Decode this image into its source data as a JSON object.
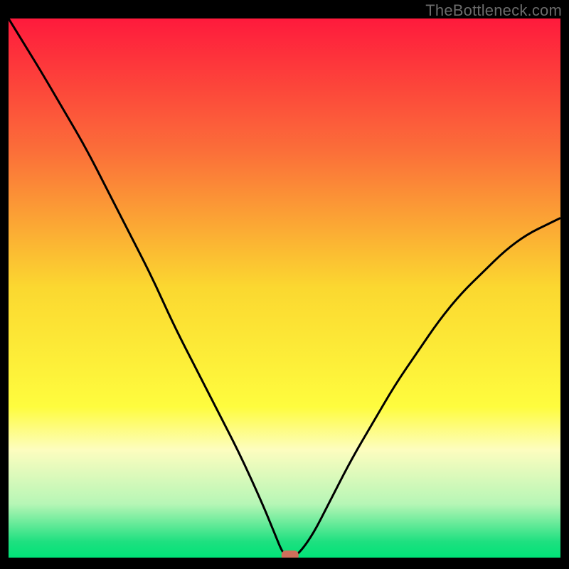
{
  "watermark": "TheBottleneck.com",
  "chart_data": {
    "type": "line",
    "title": "",
    "xlabel": "",
    "ylabel": "",
    "xlim": [
      0,
      100
    ],
    "ylim": [
      0,
      100
    ],
    "legend": false,
    "grid": false,
    "background_gradient": {
      "orientation": "vertical",
      "stops": [
        {
          "percent": 0,
          "color": "#fe1a3c"
        },
        {
          "percent": 25,
          "color": "#fb7039"
        },
        {
          "percent": 50,
          "color": "#fbd830"
        },
        {
          "percent": 72,
          "color": "#fefc3e"
        },
        {
          "percent": 80,
          "color": "#fdfdbf"
        },
        {
          "percent": 90,
          "color": "#b7f6b6"
        },
        {
          "percent": 97,
          "color": "#1fe080"
        },
        {
          "percent": 100,
          "color": "#00e277"
        }
      ]
    },
    "series": [
      {
        "name": "bottleneck-curve",
        "color": "#000000",
        "x": [
          0,
          3,
          6,
          10,
          14,
          18,
          22,
          26,
          30,
          34,
          38,
          42,
          46,
          48,
          50,
          52,
          55,
          58,
          62,
          66,
          70,
          74,
          78,
          82,
          86,
          90,
          94,
          98,
          100
        ],
        "y": [
          100,
          95,
          90,
          83,
          76,
          68,
          60,
          52,
          43,
          35,
          27,
          19,
          10,
          5,
          0,
          0,
          4,
          10,
          18,
          25,
          32,
          38,
          44,
          49,
          53,
          57,
          60,
          62,
          63
        ]
      }
    ],
    "markers": [
      {
        "name": "optimum-point",
        "x": 51,
        "y": 0,
        "color": "#cf6f5b",
        "shape": "rounded-rect"
      }
    ]
  }
}
